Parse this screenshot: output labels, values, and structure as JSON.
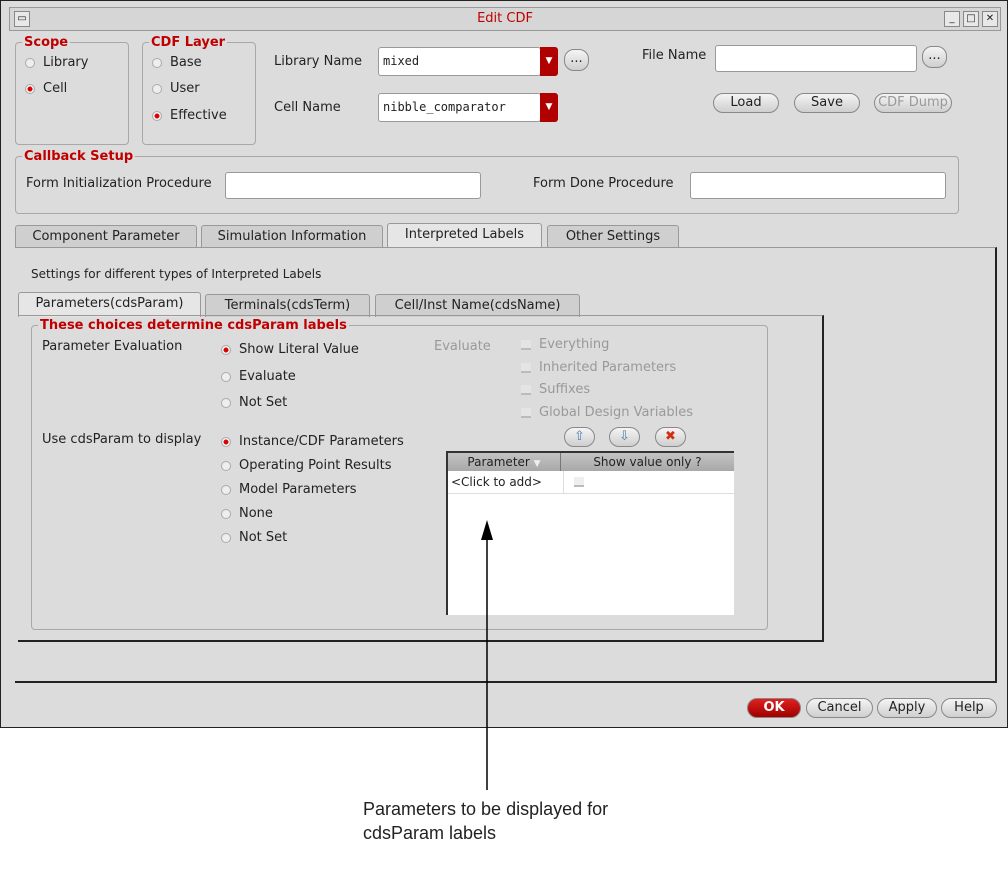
{
  "window": {
    "title": "Edit CDF"
  },
  "scope": {
    "legend": "Scope",
    "options": [
      "Library",
      "Cell"
    ],
    "selected": "Cell"
  },
  "cdf_layer": {
    "legend": "CDF Layer",
    "options": [
      "Base",
      "User",
      "Effective"
    ],
    "selected": "Effective"
  },
  "library_name": {
    "label": "Library Name",
    "value": "mixed",
    "browse": "..."
  },
  "cell_name": {
    "label": "Cell Name",
    "value": "nibble_comparator"
  },
  "file_name": {
    "label": "File Name",
    "value": "",
    "browse": "..."
  },
  "file_buttons": {
    "load": "Load",
    "save": "Save",
    "cdf_dump": "CDF Dump"
  },
  "callback": {
    "legend": "Callback Setup",
    "init_label": "Form Initialization Procedure",
    "init_value": "",
    "done_label": "Form Done Procedure",
    "done_value": ""
  },
  "tabs": [
    "Component Parameter",
    "Simulation Information",
    "Interpreted Labels",
    "Other Settings"
  ],
  "active_tab": "Interpreted Labels",
  "labels_panel": {
    "description": "Settings for different types of Interpreted Labels",
    "subtabs": [
      "Parameters(cdsParam)",
      "Terminals(cdsTerm)",
      "Cell/Inst Name(cdsName)"
    ],
    "legend": "These choices determine cdsParam labels",
    "param_eval": {
      "label": "Parameter Evaluation",
      "options": [
        "Show Literal Value",
        "Evaluate",
        "Not Set"
      ],
      "selected": "Show Literal Value"
    },
    "evaluate": {
      "label": "Evaluate",
      "options": [
        "Everything",
        "Inherited Parameters",
        "Suffixes",
        "Global Design Variables"
      ]
    },
    "use_display": {
      "label": "Use cdsParam to display",
      "options": [
        "Instance/CDF Parameters",
        "Operating Point Results",
        "Model Parameters",
        "None",
        "Not Set"
      ],
      "selected": "Instance/CDF Parameters"
    },
    "table": {
      "columns": [
        "Parameter",
        "Show value only ?"
      ],
      "rows": [
        [
          "<Click to add>",
          ""
        ]
      ]
    }
  },
  "footer": {
    "ok": "OK",
    "cancel": "Cancel",
    "apply": "Apply",
    "help": "Help"
  },
  "annotation": {
    "line1": "Parameters to be displayed for",
    "line2": "cdsParam labels"
  }
}
